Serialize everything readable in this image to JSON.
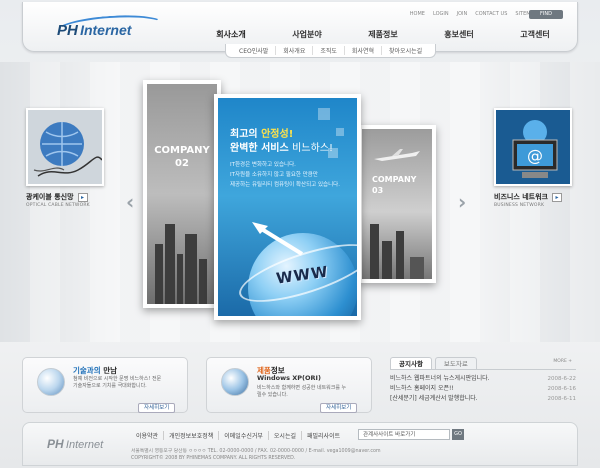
{
  "header": {
    "logo_ph": "PH",
    "logo_net": "Internet",
    "util_links": [
      "HOME",
      "LOGIN",
      "JOIN",
      "CONTACT US",
      "SITEMAP"
    ],
    "search_label": "FIND",
    "nav": [
      "회사소개",
      "사업분야",
      "제품정보",
      "홍보센터",
      "고객센터"
    ],
    "subnav": [
      "CEO인사말",
      "회사개요",
      "조직도",
      "회사연혁",
      "찾아오시는길"
    ]
  },
  "hero": {
    "left_card": {
      "label": "광케이블 통신망",
      "sub": "OPTICAL CABLE NETWORK"
    },
    "right_card": {
      "label": "비즈니스 네트워크",
      "sub": "BUSINESS NETWORK"
    },
    "card2": {
      "line1": "COMPANY",
      "line2": "02"
    },
    "card3": {
      "line1": "COMPANY",
      "line2": "03"
    },
    "main": {
      "line1_pre": "최고의 ",
      "line1_hl": "안정성!",
      "line2_pre": "완벽한 서비스 ",
      "line2_light": "비느하스!",
      "body1": "IT환경은 변화하고 있습니다.",
      "body2": "IT자원을 소유하지 않고 필요한 만큼만",
      "body3": "제공하는 유틸리티 컴퓨팅이 확산되고 있습니다.",
      "www": "WWW"
    },
    "arrow_left": "‹",
    "arrow_right": "›"
  },
  "panels": {
    "tech": {
      "title_hl": "기술과의",
      "title_rest": " 만남",
      "desc": "첨예 비전으로 시작한 문명 비느하스! 전문기술자들으로 기치를 극대화합니다.",
      "more": "자세히보기"
    },
    "product": {
      "title_hl": "제품",
      "title_rest": "정보",
      "sub": "Windows XP(ORI)",
      "desc": "비느하스와 함께하면 성공한 네트워크를 누릴수 있습니다.",
      "more": "자세히보기"
    },
    "notice": {
      "tabs": [
        "공지사항",
        "보도자료"
      ],
      "more": "MORE +",
      "items": [
        {
          "title": "비느하스 웹파트너의 뉴스게시판입니다.",
          "date": "2008-6-22"
        },
        {
          "title": "비느하스 홈페이지 오픈!!",
          "date": "2008-6-16"
        },
        {
          "title": "[산세분기] 세금계산서 발행합니다.",
          "date": "2008-6-11"
        }
      ]
    }
  },
  "footer": {
    "logo_ph": "PH",
    "logo_net": "Internet",
    "links": [
      "이용약관",
      "개인정보보호정책",
      "이메일수신거부",
      "오시는길",
      "패밀리사이트"
    ],
    "family_select": "관계사사이트 바로가기",
    "family_go": "GO",
    "addr1": "서울특별시 영등포구 당산동 ㅇㅇㅇㅇ  TEL. 02-0000-0000  /  FAX. 02-0000-0000  /  E-mail. vega1009@naver.com",
    "addr2": "COPYRIGHT© 2008 BY PHINEMAS COMPANY. ALL RIGHTS RESERVED."
  }
}
